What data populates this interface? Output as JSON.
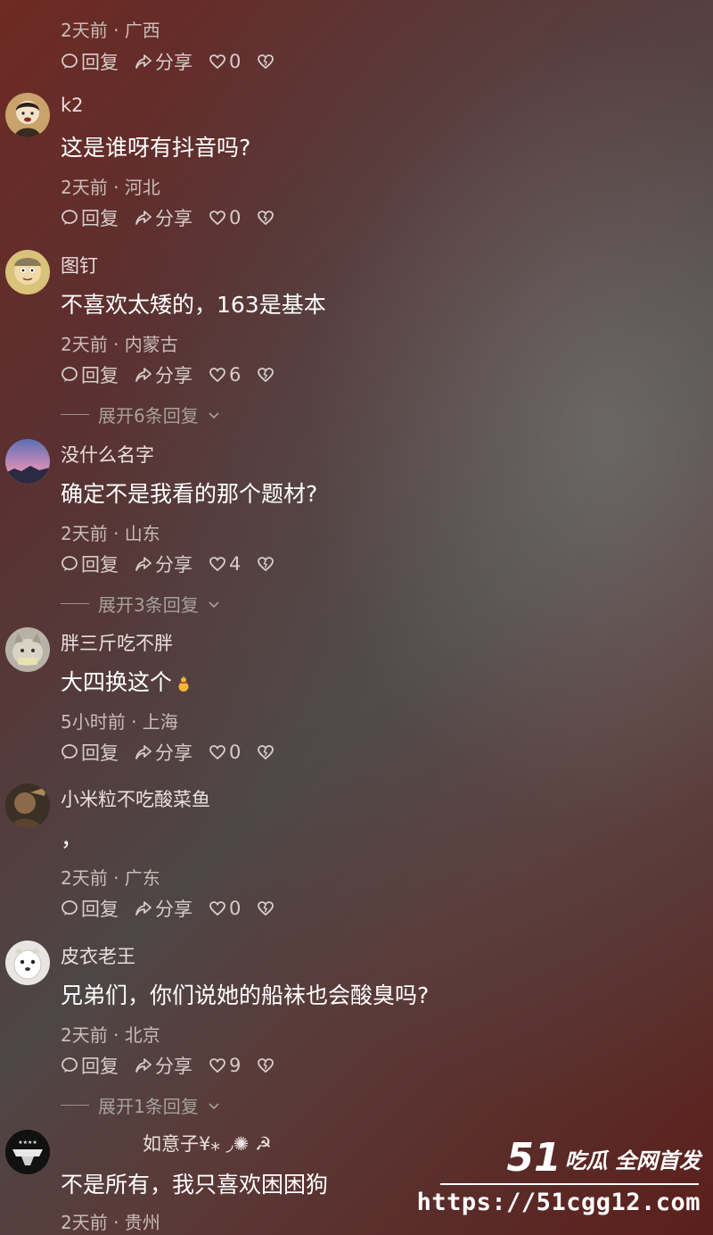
{
  "actions": {
    "reply": "回复",
    "share": "分享"
  },
  "comments": [
    {
      "user": "",
      "text": "",
      "meta": "2天前 · 广西",
      "likes": "0",
      "expand": ""
    },
    {
      "user": "k2",
      "text": "这是谁呀有抖音吗?",
      "meta": "2天前 · 河北",
      "likes": "0",
      "expand": ""
    },
    {
      "user": "图钉",
      "text": "不喜欢太矮的，163是基本",
      "meta": "2天前 · 内蒙古",
      "likes": "6",
      "expand": "展开6条回复"
    },
    {
      "user": "没什么名字",
      "text": "确定不是我看的那个题材?",
      "meta": "2天前 · 山东",
      "likes": "4",
      "expand": "展开3条回复"
    },
    {
      "user": "胖三斤吃不胖",
      "text": "大四换这个",
      "meta": "5小时前 · 上海",
      "likes": "0",
      "expand": ""
    },
    {
      "user": "小米粒不吃酸菜鱼",
      "text": "，",
      "meta": "2天前 · 广东",
      "likes": "0",
      "expand": ""
    },
    {
      "user": "皮衣老王",
      "text": "兄弟们，你们说她的船袜也会酸臭吗?",
      "meta": "2天前 · 北京",
      "likes": "9",
      "expand": "展开1条回复"
    },
    {
      "user": "如意子¥⁎ ◞✺ ☭",
      "text": "不是所有，我只喜欢困困狗",
      "meta": "2天前 · 贵州",
      "likes": "",
      "expand": ""
    }
  ],
  "watermark": {
    "brand_num": "51",
    "brand_text": "吃瓜 全网首发",
    "url": "https://51cgg12.com"
  }
}
